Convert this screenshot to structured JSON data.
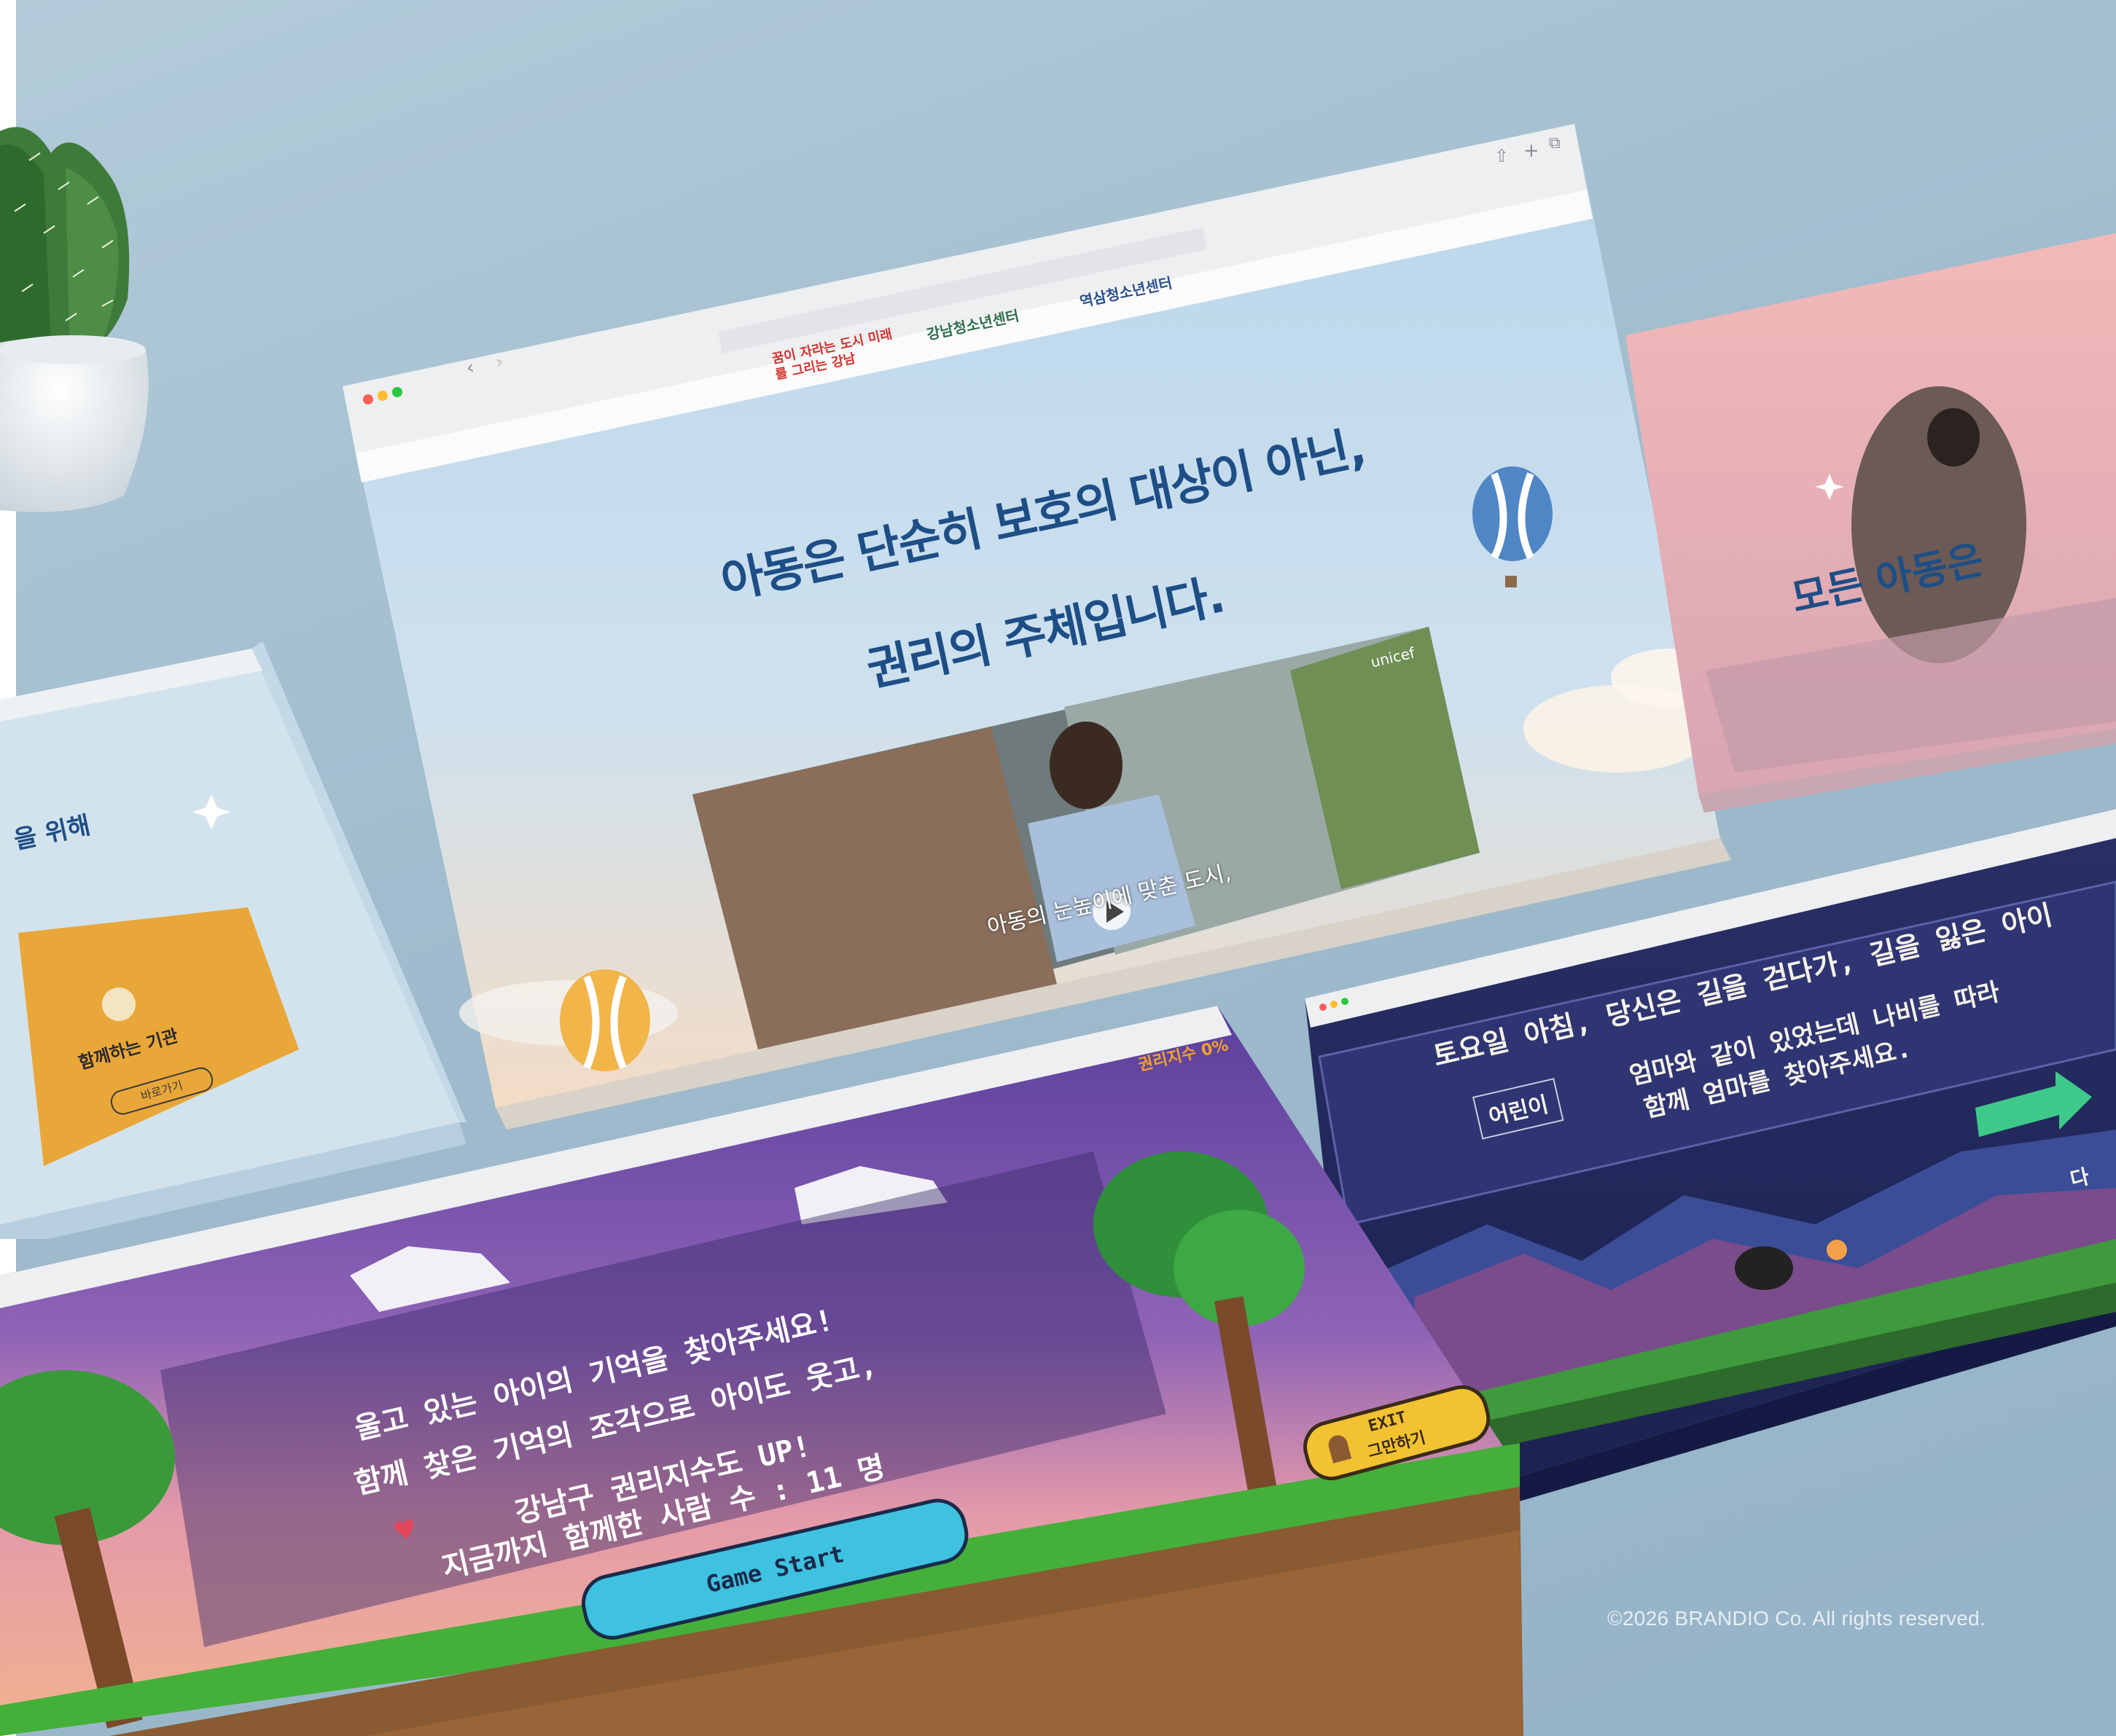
{
  "main_browser": {
    "logos": [
      "꿈이 자라는 도시 미래를 그리는 강남",
      "강남청소년센터",
      "역삼청소년센터"
    ],
    "hero_line1": "아동은 단순히 보호의 대상이 아닌,",
    "hero_line2": "권리의 주체입니다.",
    "video_caption": "아동의 눈높이에 맞춘 도시,",
    "video_brand": "unicef"
  },
  "left_card": {
    "heading_fragment": "을 위해",
    "card_title": "함께하는 기관",
    "card_button": "바로가기"
  },
  "right_card": {
    "heading": "모든 아동은"
  },
  "game_browser": {
    "top_label": "권리지수 0%",
    "line1": "울고 있는 아이의 기억을 찾아주세요!",
    "line2": "함께 찾은 기억의 조각으로 아이도 웃고,",
    "line3": "강남구 권리지수도 UP!",
    "count_label": "지금까지 함께한 사람 수 : 11 명",
    "start_button": "Game Start",
    "exit_button_en": "EXIT",
    "exit_button_ko": "그만하기"
  },
  "story_browser": {
    "line1": "토요일 아침, 당신은 길을 걷다가, 길을 잃은 아이",
    "speaker": "어린이",
    "line2": "엄마와 같이 있었는데 나비를 따라",
    "line3": "함께 엄마를 찾아주세요.",
    "next_label": "다"
  },
  "footer": {
    "copyright": "©2026 BRANDIO Co. All rights reserved."
  },
  "colors": {
    "background": "#a7c1d1",
    "hero_title": "#1e4e86",
    "game_purple": "#6b4ea6",
    "start_button": "#3fc1e0",
    "exit_button": "#f2c230",
    "card_yellow": "#e9a73a",
    "story_bg": "#23285a"
  }
}
